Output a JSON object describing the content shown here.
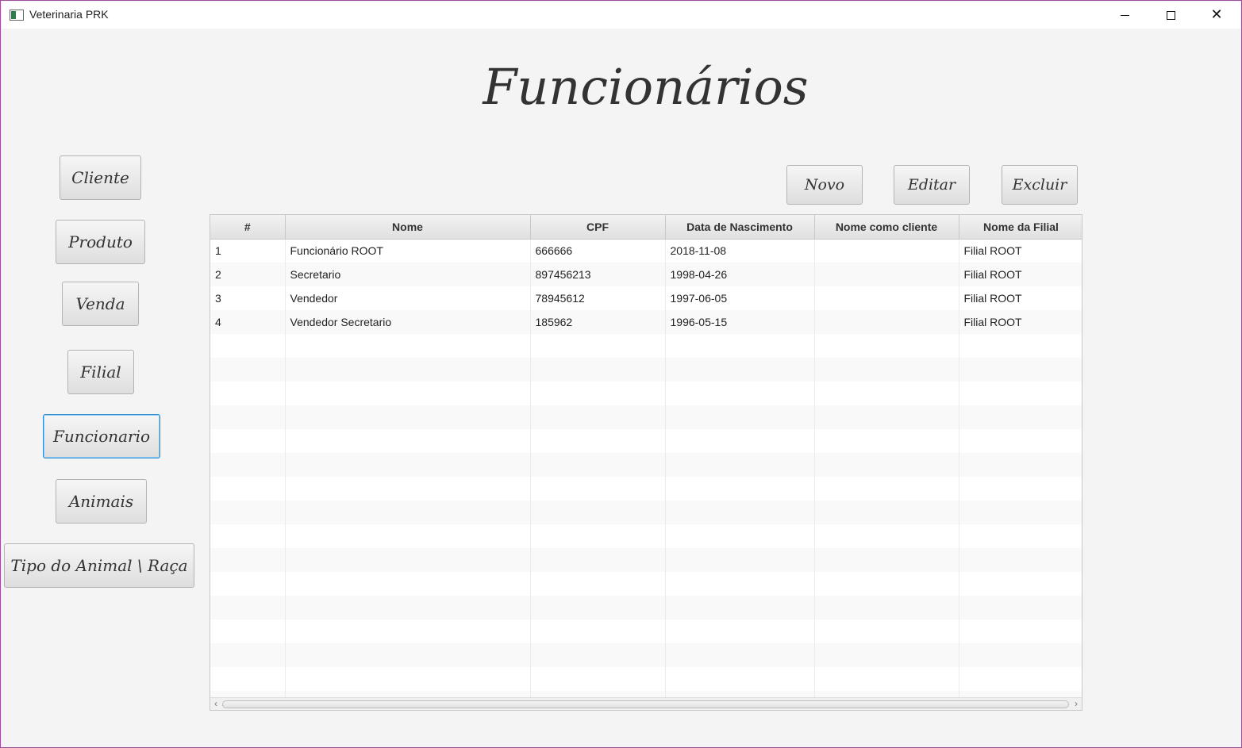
{
  "window": {
    "title": "Veterinaria PRK"
  },
  "page": {
    "title": "Funcionários"
  },
  "nav": {
    "cliente": "Cliente",
    "produto": "Produto",
    "venda": "Venda",
    "filial": "Filial",
    "funcionario": "Funcionario",
    "animais": "Animais",
    "tipo_animal": "Tipo do Animal \\ Raça"
  },
  "actions": {
    "novo": "Novo",
    "editar": "Editar",
    "excluir": "Excluir"
  },
  "table": {
    "columns": [
      "#",
      "Nome",
      "CPF",
      "Data de Nascimento",
      "Nome como cliente",
      "Nome da Filial"
    ],
    "rows": [
      [
        "1",
        "Funcionário ROOT",
        "666666",
        "2018-11-08",
        "",
        "Filial ROOT"
      ],
      [
        "2",
        "Secretario",
        "897456213",
        "1998-04-26",
        "",
        "Filial ROOT"
      ],
      [
        "3",
        "Vendedor",
        "78945612",
        "1997-06-05",
        "",
        "Filial ROOT"
      ],
      [
        "4",
        "Vendedor Secretario",
        "185962",
        "1996-05-15",
        "",
        "Filial ROOT"
      ]
    ]
  }
}
